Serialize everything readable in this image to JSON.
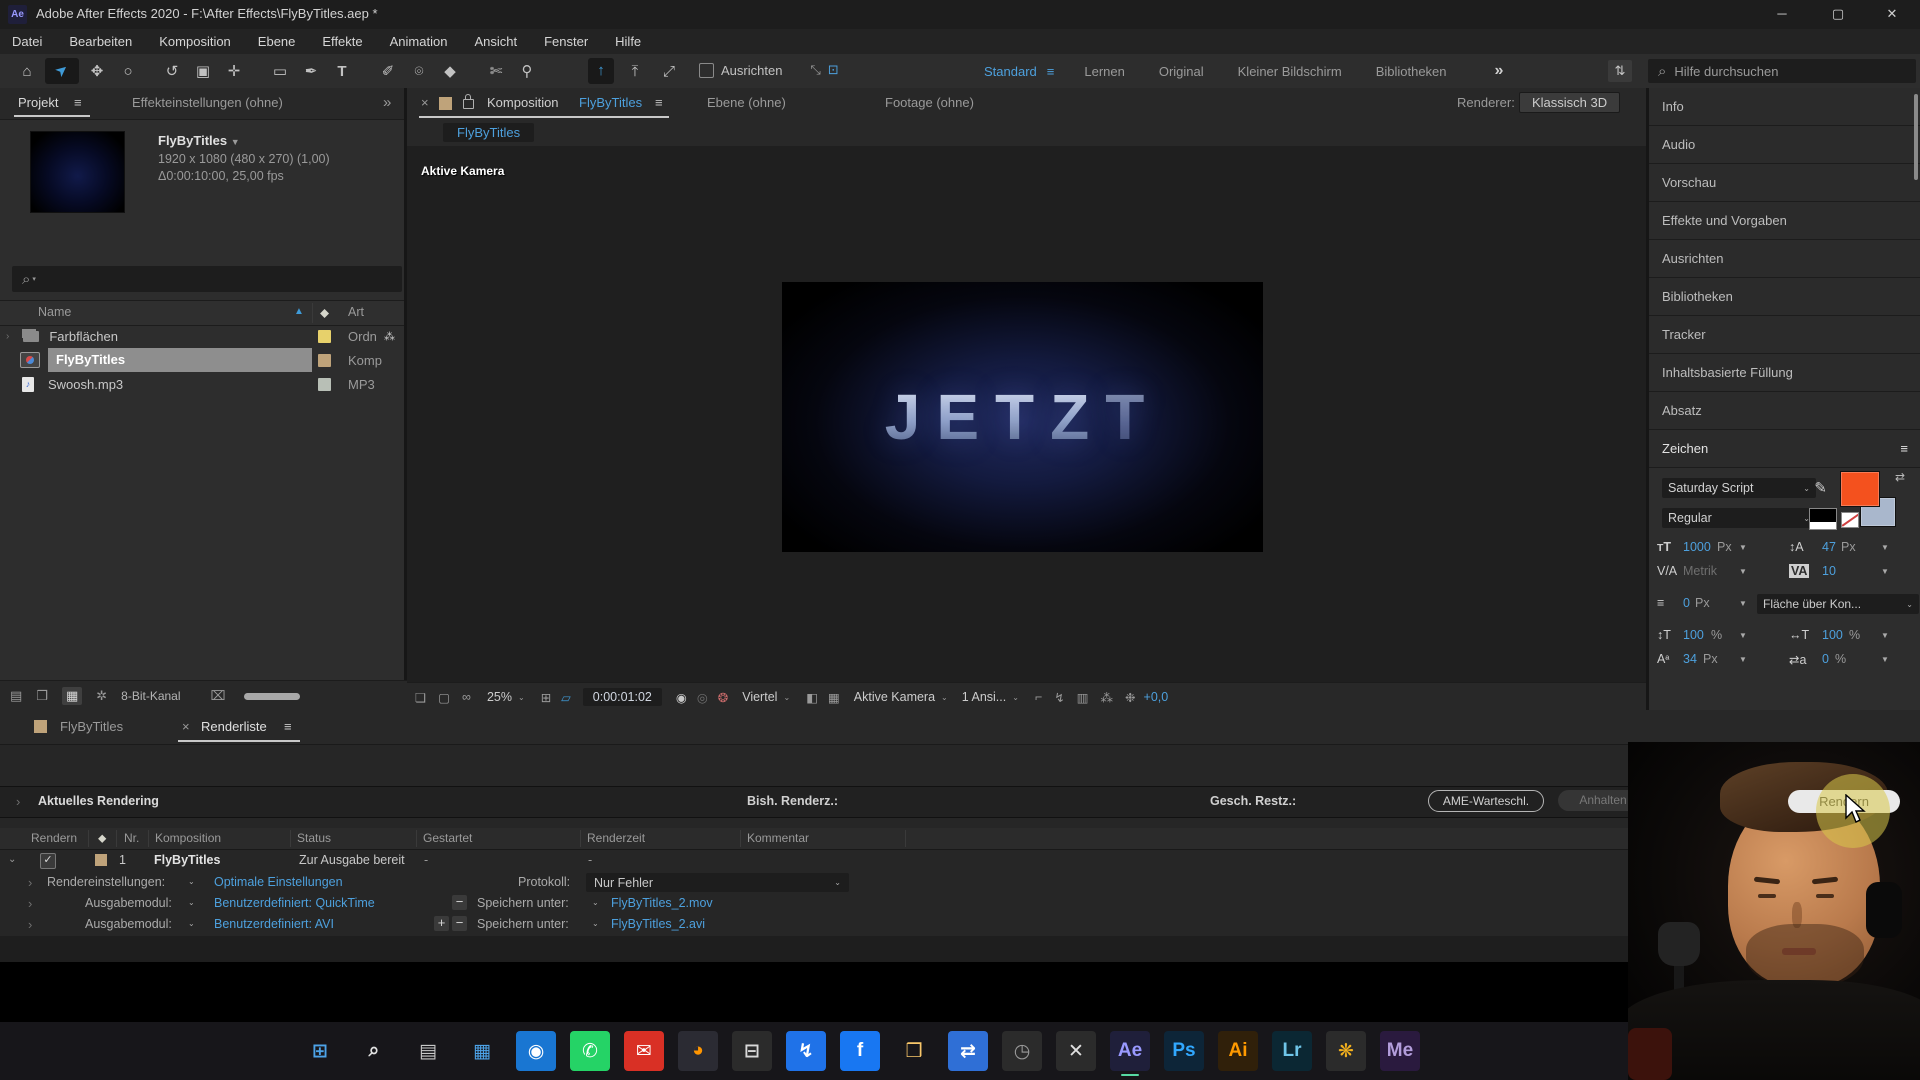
{
  "window": {
    "app_badge": "Ae",
    "title": "Adobe After Effects 2020 - F:\\After Effects\\FlyByTitles.aep *",
    "controls": {
      "minimize": "─",
      "maximize": "▢",
      "close": "✕"
    }
  },
  "menu_bar": {
    "items": [
      "Datei",
      "Bearbeiten",
      "Komposition",
      "Ebene",
      "Effekte",
      "Animation",
      "Ansicht",
      "Fenster",
      "Hilfe"
    ]
  },
  "toolbar": {
    "tools": [
      {
        "name": "home",
        "glyph": "⌂"
      },
      {
        "name": "selection",
        "glyph": "➤"
      },
      {
        "name": "hand",
        "glyph": "✥"
      },
      {
        "name": "zoom",
        "glyph": "○"
      },
      {
        "name": "orbit",
        "glyph": "↺"
      },
      {
        "name": "camera",
        "glyph": "▣"
      },
      {
        "name": "pan-behind",
        "glyph": "✛"
      },
      {
        "name": "rectangle",
        "glyph": "▭"
      },
      {
        "name": "pen",
        "glyph": "✒"
      },
      {
        "name": "type",
        "glyph": "T"
      },
      {
        "name": "brush",
        "glyph": "✐"
      },
      {
        "name": "clone-stamp",
        "glyph": "⌾"
      },
      {
        "name": "eraser",
        "glyph": "◆"
      },
      {
        "name": "roto-brush",
        "glyph": "✄"
      },
      {
        "name": "puppet-pin",
        "glyph": "⚲"
      },
      {
        "name": "axis-local",
        "glyph": "↑"
      },
      {
        "name": "axis-world",
        "glyph": "⤒"
      },
      {
        "name": "axis-view",
        "glyph": "⤢"
      }
    ],
    "snap_label": "Ausrichten",
    "expand_icons": [
      "⤡",
      "⊡"
    ],
    "workspaces": [
      {
        "label": "Standard"
      },
      {
        "label": "Lernen"
      },
      {
        "label": "Original"
      },
      {
        "label": "Kleiner Bildschirm"
      },
      {
        "label": "Bibliotheken"
      }
    ],
    "workspace_menu_glyph": "≡",
    "overflow_glyph": "»",
    "panel_settings_glyph": "⇅",
    "search_icon": "⌕",
    "search_placeholder": "Hilfe durchsuchen"
  },
  "project_panel": {
    "tabs": [
      {
        "label": "Projekt"
      },
      {
        "label": "Effekteinstellungen (ohne)"
      }
    ],
    "tab_menu_glyph": "≡",
    "overflow_glyph": "»",
    "preview": {
      "name": "FlyByTitles",
      "dropdown": "▼",
      "line1": "1920 x 1080 (480 x 270) (1,00)",
      "line2": "Δ0:00:10:00, 25,00 fps"
    },
    "search_icon": "⌕",
    "columns": {
      "name": "Name",
      "sort_glyph": "▲",
      "tag_glyph": "⬥",
      "type": "Art"
    },
    "items": [
      {
        "name": "Farbflächen",
        "type": "Ordn",
        "label_color": "#e7d16b"
      },
      {
        "name": "FlyByTitles",
        "type": "Komp",
        "label_color": "#bfa37a"
      },
      {
        "name": "Swoosh.mp3",
        "type": "MP3",
        "label_color": "#b8bfb6"
      }
    ],
    "footer": {
      "icons": [
        "▤",
        "❒",
        "▦",
        "✲"
      ],
      "depth_label": "8-Bit-Kanal",
      "trash_glyph": "⌧"
    }
  },
  "comp_panel": {
    "close_glyph": "×",
    "tab_active_prefix": "Komposition",
    "tab_active_comp": "FlyByTitles",
    "tab_menu_glyph": "≡",
    "tab2": "Ebene (ohne)",
    "tab3": "Footage (ohne)",
    "renderer_label": "Renderer:",
    "renderer_value": "Klassisch 3D",
    "breadcrumb": "FlyByTitles",
    "camera_label": "Aktive Kamera",
    "canvas_text_bright": "JETZ",
    "canvas_text_dim": "T",
    "toolbar": {
      "icons_left": [
        "❏",
        "▢",
        "∞"
      ],
      "zoom": "25%",
      "safe_margin_glyph": "⊞",
      "roi_glyph": "▱",
      "timecode": "0:00:01:02",
      "snapshot_glyph": "◉",
      "show_snapshot_glyph": "◎",
      "channels_glyph": "❂",
      "resolution": "Viertel",
      "grid_glyphs": [
        "◧",
        "▦"
      ],
      "view": "Aktive Kamera",
      "layout": "1 Ansi...",
      "icons_right": [
        "⌐",
        "↯",
        "▥",
        "⁂",
        "❉"
      ],
      "exposure": "+0,0"
    }
  },
  "right_panel": {
    "tabs": [
      "Info",
      "Audio",
      "Vorschau",
      "Effekte und Vorgaben",
      "Ausrichten",
      "Bibliotheken",
      "Tracker",
      "Inhaltsbasierte Füllung",
      "Absatz"
    ],
    "character": {
      "title": "Zeichen",
      "menu_glyph": "≡",
      "font_family": "Saturday Script",
      "font_style": "Regular",
      "eyedropper_glyph": "✐",
      "fill_color": "#f4511e",
      "stroke_color": "#a9b7cc",
      "swap_glyph": "⇄",
      "font_size": "1000",
      "font_size_unit": "Px",
      "leading": "47",
      "leading_unit": "Px",
      "kerning": "Metrik",
      "tracking": "10",
      "stroke_width": "0",
      "stroke_width_unit": "Px",
      "stroke_mode": "Fläche über Kon...",
      "v_scale": "100",
      "v_scale_unit": "%",
      "h_scale": "100",
      "h_scale_unit": "%",
      "baseline": "34",
      "baseline_unit": "Px",
      "tsume": "0",
      "tsume_unit": "%"
    }
  },
  "render_queue": {
    "tab1": "FlyByTitles",
    "tab2": "Renderliste",
    "tab_close_glyph": "×",
    "tab_menu_glyph": "≡",
    "current_label": "Aktuelles Rendering",
    "elapsed_label": "Bish. Renderz.:",
    "remaining_label": "Gesch. Restz.:",
    "ame_button": "AME-Warteschl.",
    "pause_button": "Anhalten",
    "render_button": "Rendern",
    "columns": {
      "render": "Rendern",
      "tag_glyph": "⬥",
      "nr": "Nr.",
      "comp": "Komposition",
      "status": "Status",
      "started": "Gestartet",
      "rendertime": "Renderzeit",
      "comment": "Kommentar"
    },
    "job": {
      "check": "✓",
      "nr": "1",
      "comp": "FlyByTitles",
      "status": "Zur Ausgabe bereit",
      "started": "-",
      "rendertime": "-"
    },
    "settings_label": "Rendereinstellungen:",
    "settings_value": "Optimale Einstellungen",
    "log_label": "Protokoll:",
    "log_value": "Nur Fehler",
    "module_label_1": "Ausgabemodul:",
    "module_value_1": "Benutzerdefiniert: QuickTime",
    "save_label_1": "Speichern unter:",
    "save_value_1": "FlyByTitles_2.mov",
    "module_label_2": "Ausgabemodul:",
    "module_value_2": "Benutzerdefiniert: AVI",
    "save_label_2": "Speichern unter:",
    "save_value_2": "FlyByTitles_2.avi",
    "minus_glyph": "−",
    "plus_glyph": "+"
  },
  "taskbar": {
    "icons": [
      {
        "name": "start",
        "glyph": "⊞",
        "bg": "transparent",
        "fg": "#4da3e8",
        "ul": "transparent"
      },
      {
        "name": "search",
        "glyph": "⌕",
        "bg": "transparent",
        "fg": "#e0e0e0",
        "ul": "transparent"
      },
      {
        "name": "task-view",
        "glyph": "▤",
        "bg": "transparent",
        "fg": "#c9c9c9",
        "ul": "transparent"
      },
      {
        "name": "mail",
        "glyph": "▦",
        "bg": "transparent",
        "fg": "#4da3e8",
        "ul": "transparent"
      },
      {
        "name": "camera-app",
        "glyph": "◉",
        "bg": "#1976d2",
        "fg": "#ffffff",
        "ul": "transparent"
      },
      {
        "name": "whatsapp",
        "glyph": "✆",
        "bg": "#25d366",
        "fg": "#ffffff",
        "ul": "transparent"
      },
      {
        "name": "gmail",
        "glyph": "✉",
        "bg": "#d93025",
        "fg": "#ffffff",
        "ul": "transparent"
      },
      {
        "name": "firefox",
        "glyph": "◕",
        "bg": "#2b2b33",
        "fg": "#ff9500",
        "ul": "transparent"
      },
      {
        "name": "printer",
        "glyph": "⊟",
        "bg": "#2b2b2b",
        "fg": "#d8d8d8",
        "ul": "transparent"
      },
      {
        "name": "messenger",
        "glyph": "↯",
        "bg": "#1f72e8",
        "fg": "#ffffff",
        "ul": "transparent"
      },
      {
        "name": "facebook",
        "glyph": "f",
        "bg": "#1877f2",
        "fg": "#ffffff",
        "ul": "transparent"
      },
      {
        "name": "explorer",
        "glyph": "❒",
        "bg": "transparent",
        "fg": "#f8c66a",
        "ul": "transparent"
      },
      {
        "name": "remote-desktop",
        "glyph": "⇄",
        "bg": "#2f6fd6",
        "fg": "#ffffff",
        "ul": "transparent"
      },
      {
        "name": "clock-app",
        "glyph": "◷",
        "bg": "#2b2b2b",
        "fg": "#9a9a9a",
        "ul": "transparent"
      },
      {
        "name": "editor-app",
        "glyph": "✕",
        "bg": "#2b2b2b",
        "fg": "#e0e0e0",
        "ul": "transparent"
      },
      {
        "name": "after-effects",
        "glyph": "Ae",
        "bg": "#1f1f3a",
        "fg": "#9999ff",
        "ul": "#57d9a3"
      },
      {
        "name": "photoshop",
        "glyph": "Ps",
        "bg": "#0d2538",
        "fg": "#31a8ff",
        "ul": "transparent"
      },
      {
        "name": "illustrator",
        "glyph": "Ai",
        "bg": "#30200a",
        "fg": "#ff9a00",
        "ul": "transparent"
      },
      {
        "name": "lightroom",
        "glyph": "Lr",
        "bg": "#0b2733",
        "fg": "#6fc5e8",
        "ul": "transparent"
      },
      {
        "name": "color-wheel",
        "glyph": "❋",
        "bg": "#2b2b2b",
        "fg": "#f2b01e",
        "ul": "transparent"
      },
      {
        "name": "media-encoder",
        "glyph": "Me",
        "bg": "#2a1a3e",
        "fg": "#b39ddb",
        "ul": "transparent"
      }
    ]
  }
}
